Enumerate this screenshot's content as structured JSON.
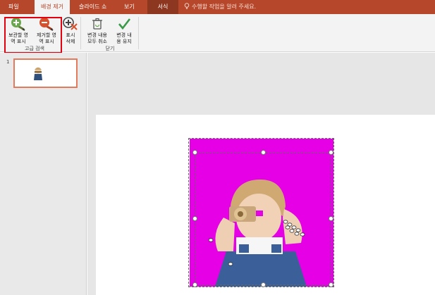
{
  "menubar": {
    "tabs": [
      {
        "label": "파일"
      },
      {
        "label": "배경 제거"
      },
      {
        "label": "슬라이드 쇼"
      },
      {
        "label": "보기"
      },
      {
        "label": "서식"
      }
    ],
    "tell_me": "수행할 작업을 알려 주세요."
  },
  "ribbon": {
    "mark_keep": {
      "line1": "보관할 영",
      "line2": "역 표시"
    },
    "mark_remove": {
      "line1": "제거할 영",
      "line2": "역 표시"
    },
    "delete_mark": {
      "line1": "표시",
      "line2": "삭제"
    },
    "group_refine": "고급 검색",
    "discard_changes": {
      "line1": "변경 내용",
      "line2": "모두 취소"
    },
    "keep_changes": {
      "line1": "변경 내",
      "line2": "용 유지"
    },
    "group_close": "닫기"
  },
  "thumbnails": {
    "slide_number": "1"
  },
  "colors": {
    "menubar": "#b7472a",
    "removal_overlay": "#e600e6",
    "highlight": "#e3000f",
    "thumb_border": "#e27a5b"
  }
}
